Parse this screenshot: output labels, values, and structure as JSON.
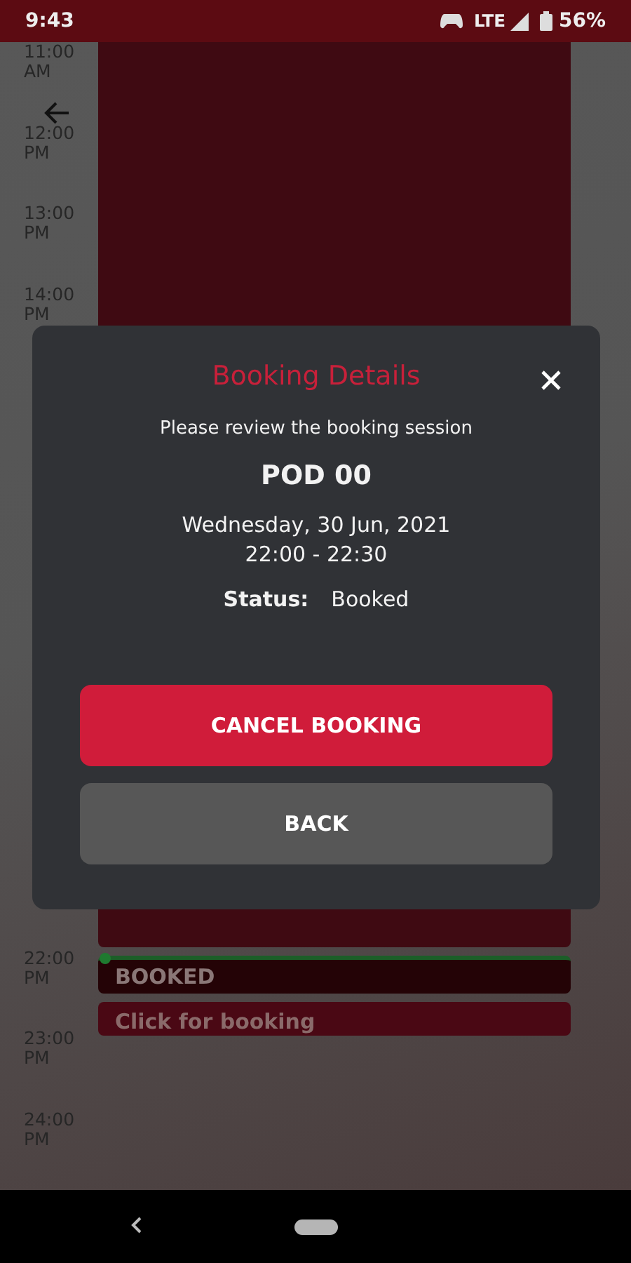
{
  "status_bar": {
    "time": "9:43",
    "network": "LTE",
    "battery": "56%"
  },
  "timeline": {
    "top_hours": [
      {
        "time": "11:00",
        "period": "AM"
      },
      {
        "time": "12:00",
        "period": "PM"
      },
      {
        "time": "13:00",
        "period": "PM"
      },
      {
        "time": "14:00",
        "period": "PM"
      }
    ],
    "bottom_hours": [
      {
        "time": "22:00",
        "period": "PM"
      },
      {
        "time": "23:00",
        "period": "PM"
      },
      {
        "time": "24:00",
        "period": "PM"
      }
    ],
    "slots": [
      {
        "kind": "block"
      },
      {
        "kind": "booked",
        "label": "BOOKED"
      },
      {
        "kind": "open",
        "label": "Click for booking"
      }
    ]
  },
  "dialog": {
    "title": "Booking Details",
    "subtitle": "Please review the booking session",
    "pod": "POD 00",
    "date": "Wednesday, 30 Jun, 2021",
    "time": "22:00 - 22:30",
    "status_label": "Status:",
    "status": "Booked",
    "buttons": [
      {
        "label": "CANCEL BOOKING",
        "kind": "primary"
      },
      {
        "label": "BACK",
        "kind": "secondary"
      }
    ]
  }
}
